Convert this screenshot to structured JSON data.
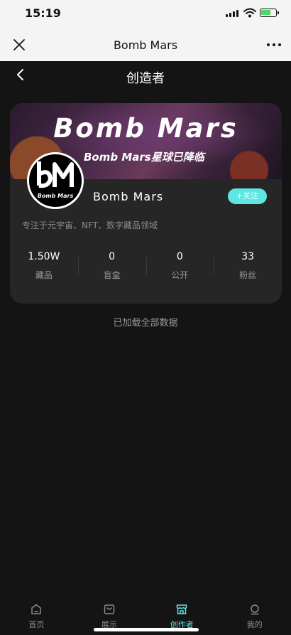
{
  "status_bar": {
    "time": "15:19"
  },
  "mp_header": {
    "title": "Bomb Mars"
  },
  "page": {
    "title": "创造者"
  },
  "creator": {
    "banner_title": "Bomb Mars",
    "banner_subtitle": "Bomb Mars星球已降临",
    "logo_text": "Bomb Mars",
    "name": "Bomb Mars",
    "follow_label": "+关注",
    "description": "专注于元宇宙、NFT、数字藏品领域",
    "stats": [
      {
        "value": "1.50W",
        "label": "藏品"
      },
      {
        "value": "0",
        "label": "盲盒"
      },
      {
        "value": "0",
        "label": "公开"
      },
      {
        "value": "33",
        "label": "粉丝"
      }
    ]
  },
  "list": {
    "end_text": "已加载全部数据"
  },
  "tab_bar": {
    "active_color": "#5ee6e2",
    "items": [
      {
        "label": "首页",
        "icon": "home-icon"
      },
      {
        "label": "展示",
        "icon": "bag-icon"
      },
      {
        "label": "创作者",
        "icon": "store-icon"
      },
      {
        "label": "我的",
        "icon": "user-icon"
      }
    ]
  }
}
